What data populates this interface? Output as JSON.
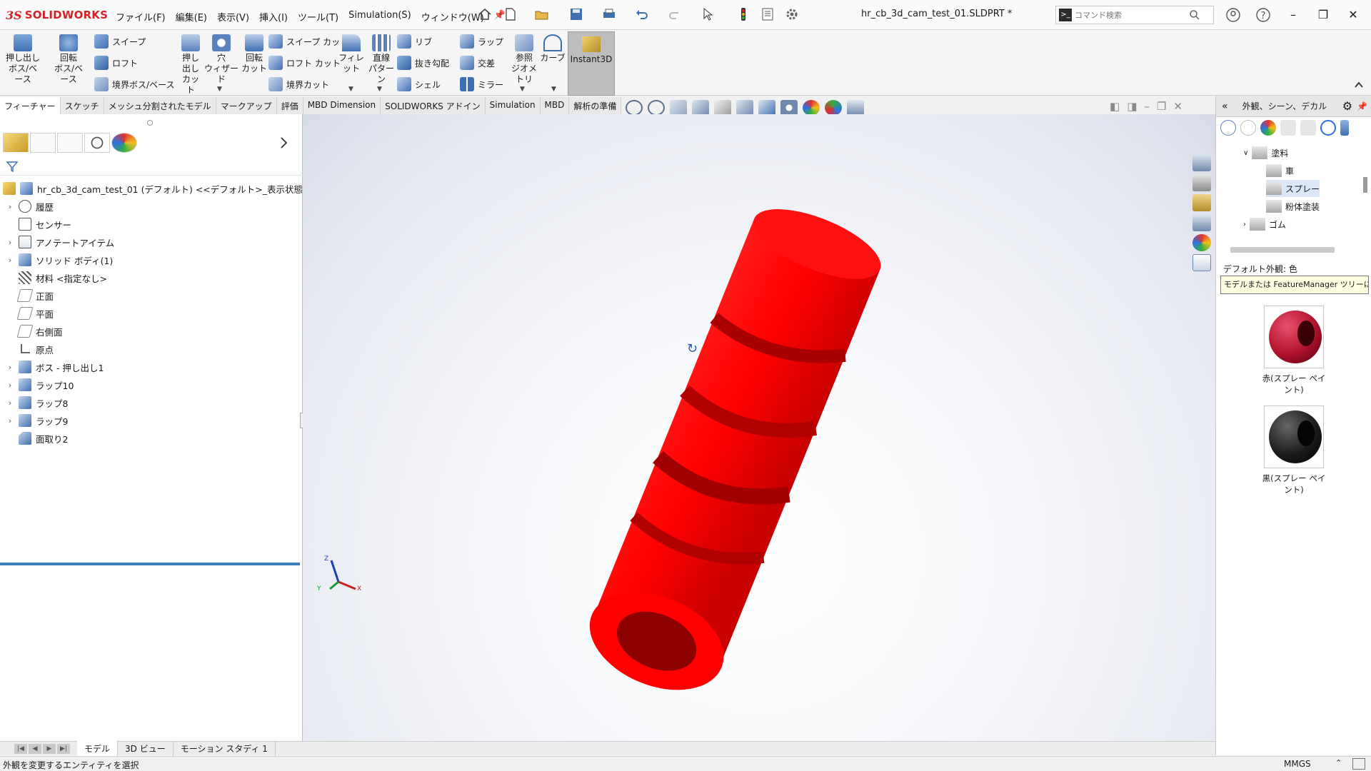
{
  "app": {
    "brand": "SOLIDWORKS",
    "ds_mark": "3S"
  },
  "menu": [
    "ファイル(F)",
    "編集(E)",
    "表示(V)",
    "挿入(I)",
    "ツール(T)",
    "Simulation(S)",
    "ウィンドウ(W)"
  ],
  "document_title": "hr_cb_3d_cam_test_01.SLDPRT *",
  "command_search": {
    "placeholder": "コマンド検索"
  },
  "features": {
    "extrude_boss": [
      "押し出し",
      "ボス/ベース"
    ],
    "revolve_boss": [
      "回転",
      "ボス/ベース"
    ],
    "sweep": "スイープ",
    "loft": "ロフト",
    "boundary_boss": "境界ボス/ベース",
    "extrude_cut": [
      "押し",
      "出し",
      "カット"
    ],
    "hole_wizard": [
      "穴",
      "ウィザード"
    ],
    "revolve_cut": [
      "回転",
      "カット"
    ],
    "swept_cut": "スイープ カット",
    "lofted_cut": "ロフト カット",
    "boundary_cut": "境界カット",
    "fillet": "フィレット",
    "linear_pattern": [
      "直線",
      "パターン"
    ],
    "rib": "リブ",
    "draft": "抜き勾配",
    "shell": "シェル",
    "wrap": "ラップ",
    "intersect": "交差",
    "mirror": "ミラー",
    "ref_geometry": [
      "参照",
      "ジオメトリ"
    ],
    "curves": "カーブ",
    "instant3d": "Instant3D"
  },
  "command_tabs": [
    "フィーチャー",
    "スケッチ",
    "メッシュ分割されたモデル",
    "マークアップ",
    "評価",
    "MBD Dimension",
    "SOLIDWORKS アドイン",
    "Simulation",
    "MBD",
    "解析の準備"
  ],
  "tree": {
    "root": "hr_cb_3d_cam_test_01 (デフォルト) <<デフォルト>_表示状態 1>",
    "items": [
      {
        "label": "履歴",
        "expandable": true
      },
      {
        "label": "センサー",
        "expandable": false
      },
      {
        "label": "アノテートアイテム",
        "expandable": true
      },
      {
        "label": "ソリッド ボディ(1)",
        "expandable": true
      },
      {
        "label": "材料 <指定なし>",
        "expandable": false
      },
      {
        "label": "正面",
        "expandable": false
      },
      {
        "label": "平面",
        "expandable": false
      },
      {
        "label": "右側面",
        "expandable": false
      },
      {
        "label": "原点",
        "expandable": false
      },
      {
        "label": "ボス - 押し出し1",
        "expandable": true
      },
      {
        "label": "ラップ10",
        "expandable": true
      },
      {
        "label": "ラップ8",
        "expandable": true
      },
      {
        "label": "ラップ9",
        "expandable": true
      },
      {
        "label": "面取り2",
        "expandable": false
      }
    ]
  },
  "taskpane": {
    "title": "外観、シーン、デカル",
    "tree": [
      {
        "label": "塗料",
        "level": 1,
        "expanded": true
      },
      {
        "label": "車",
        "level": 2
      },
      {
        "label": "スプレー",
        "level": 2,
        "selected": true
      },
      {
        "label": "粉体塗装",
        "level": 2
      },
      {
        "label": "ゴム",
        "level": 1,
        "expanded": false
      }
    ],
    "default_appearance": "デフォルト外観: 色",
    "tooltip": "モデルまたは FeatureManager ツリーに...",
    "swatches": [
      {
        "label": "赤(スプレー ペイント)",
        "color": "#b0132b"
      },
      {
        "label": "黒(スプレー ペイント)",
        "color": "#1c1c1c"
      }
    ]
  },
  "triad": {
    "x": "X",
    "y": "Y",
    "z": "Z"
  },
  "bottom_tabs": [
    "モデル",
    "3D ビュー",
    "モーション スタディ 1"
  ],
  "status": {
    "text": "外観を変更するエンティティを選択",
    "units": "MMGS"
  },
  "colors": {
    "brand": "#d42027",
    "part": "#ff0000",
    "selection": "#3a7ebf"
  }
}
